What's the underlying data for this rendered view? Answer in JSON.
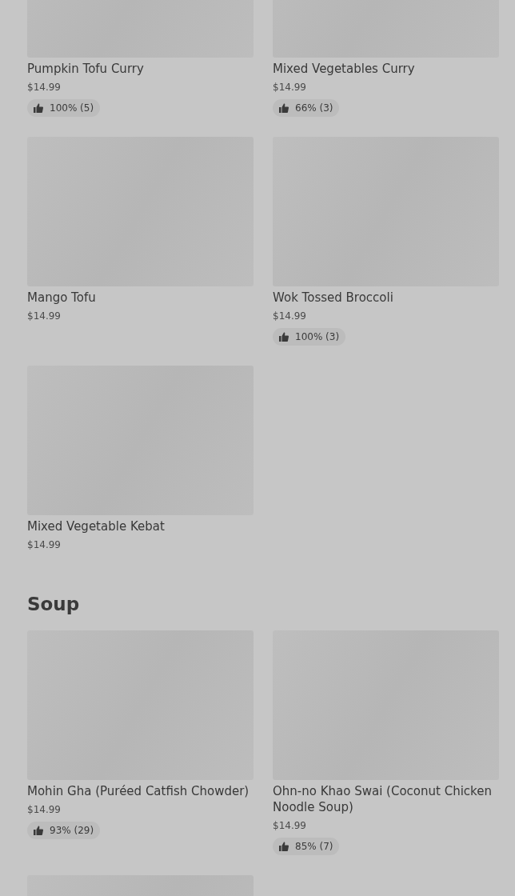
{
  "sections": [
    {
      "items": [
        {
          "kind": "dish",
          "name": "Pumpkin Tofu Curry",
          "price": "$14.99",
          "rating": "100% (5)"
        },
        {
          "kind": "dish",
          "name": "Mixed Vegetables Curry",
          "price": "$14.99",
          "rating": "66% (3)"
        },
        {
          "kind": "dish",
          "name": "Mango Tofu",
          "price": "$14.99"
        },
        {
          "kind": "dish",
          "name": "Wok Tossed Broccoli",
          "price": "$14.99",
          "rating": "100% (3)"
        },
        {
          "kind": "dish",
          "name": "Mixed Vegetable Kebat",
          "price": "$14.99"
        }
      ]
    },
    {
      "title": "Soup",
      "items": [
        {
          "kind": "dish",
          "name": "Mohin Gha (Puréed Catfish Chowder)",
          "price": "$14.99",
          "rating": "93% (29)"
        },
        {
          "kind": "dish",
          "name": "Ohn-no Khao Swai (Coconut Chicken Noodle Soup)",
          "price": "$14.99",
          "rating": "85% (7)"
        },
        {
          "kind": "dish"
        }
      ]
    }
  ]
}
